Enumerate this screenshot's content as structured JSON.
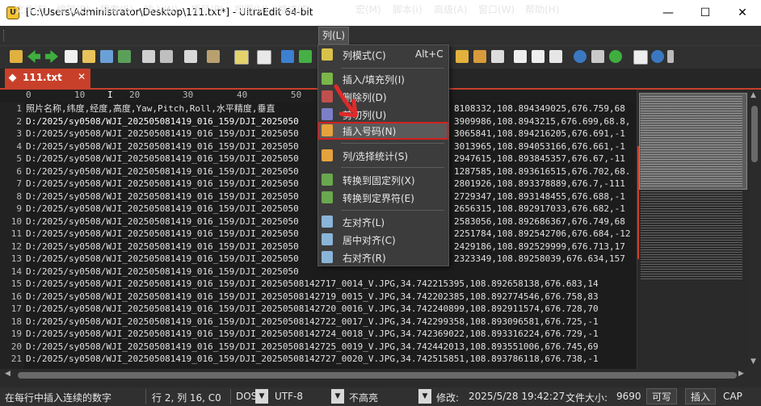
{
  "window": {
    "title": "[C:\\Users\\Administrator\\Desktop\\111.txt*] - UltraEdit 64-bit",
    "app_icon_letter": "U",
    "minimize_glyph": "—",
    "maximize_glyph": "☐",
    "close_glyph": "✕"
  },
  "menubar": {
    "items": [
      "文件(F)",
      "编辑(E)",
      "搜索(S)",
      "插入(N)",
      "项目(P)",
      "视图(V)",
      "格式(T)",
      "列(L)",
      "宏(M)",
      "脚本(i)",
      "高级(A)",
      "窗口(W)",
      "帮助(H)"
    ],
    "active_index": 7
  },
  "tab": {
    "name": "111.txt",
    "close": "✕"
  },
  "ruler": {
    "ticks": [
      "0",
      "10",
      "20",
      "30",
      "40",
      "50"
    ],
    "cursor_mark": "I"
  },
  "editor": {
    "line_numbers": [
      "1",
      "2",
      "3",
      "4",
      "5",
      "6",
      "7",
      "8",
      "9",
      "10",
      "11",
      "12",
      "13",
      "14",
      "15",
      "16",
      "17",
      "18",
      "19",
      "20",
      "21"
    ],
    "lines_left": [
      "照片名称,纬度,经度,高度,Yaw,Pitch,Roll,水平精度,垂直",
      "D:/2025/sy0508/WJI_202505081419_016_159/DJI_2025050",
      "D:/2025/sy0508/WJI_202505081419_016_159/DJI_2025050",
      "D:/2025/sy0508/WJI_202505081419_016_159/DJI_2025050",
      "D:/2025/sy0508/WJI_202505081419_016_159/DJI_2025050",
      "D:/2025/sy0508/WJI_202505081419_016_159/DJI_2025050",
      "D:/2025/sy0508/WJI_202505081419_016_159/DJI_2025050",
      "D:/2025/sy0508/WJI_202505081419_016_159/DJI_2025050",
      "D:/2025/sy0508/WJI_202505081419_016_159/DJI_2025050",
      "D:/2025/sy0508/WJI_202505081419_016_159/DJI_2025050",
      "D:/2025/sy0508/WJI_202505081419_016_159/DJI_2025050",
      "D:/2025/sy0508/WJI_202505081419_016_159/DJI_2025050",
      "D:/2025/sy0508/WJI_202505081419_016_159/DJI_2025050",
      "D:/2025/sy0508/WJI_202505081419_016_159/DJI_2025050",
      "D:/2025/sy0508/WJI_202505081419_016_159/DJI_2025050"
    ],
    "lines_right": [
      "8108332,108.894349025,676.759,68",
      "3909986,108.8943215,676.699,68.8,",
      "3065841,108.894216205,676.691,-1",
      "3013965,108.894053166,676.661,-1",
      "2947615,108.893845357,676.67,-11",
      "1287585,108.893616515,676.702,68.",
      "2801926,108.893378889,676.7,-111",
      "2729347,108.893148455,676.688,-1",
      "2656315,108.892917033,676.682,-1",
      "2583056,108.892686367,676.749,68",
      "2251784,108.892542706,676.684,-12",
      "2429186,108.892529999,676.713,17",
      "2323349,108.89258039,676.634,157"
    ],
    "lines_full": [
      "D:/2025/sy0508/WJI_202505081419_016_159/DJI_20250508142717_0014_V.JPG,34.742215395,108.892658138,676.683,14",
      "D:/2025/sy0508/WJI_202505081419_016_159/DJI_20250508142719_0015_V.JPG,34.742202385,108.892774546,676.758,83",
      "D:/2025/sy0508/WJI_202505081419_016_159/DJI_20250508142720_0016_V.JPG,34.742240899,108.892911574,676.728,70",
      "D:/2025/sy0508/WJI_202505081419_016_159/DJI_20250508142722_0017_V.JPG,34.742299358,108.893096581,676.725,-1",
      "D:/2025/sy0508/WJI_202505081419_016_159/DJI_20250508142724_0018_V.JPG,34.742369022,108.893316224,676.729,-1",
      "D:/2025/sy0508/WJI_202505081419_016_159/DJI_20250508142725_0019_V.JPG,34.742442013,108.893551006,676.745,69",
      "D:/2025/sy0508/WJI_202505081419_016_159/DJI_20250508142727_0020_V.JPG,34.742515851,108.893786118,676.738,-1"
    ]
  },
  "column_menu": {
    "items": [
      {
        "label": "列模式(C)",
        "shortcut": "Alt+C",
        "icon": "column-mode-icon",
        "color": "#d9c24a"
      },
      {
        "label": "插入/填充列(I)",
        "shortcut": "",
        "icon": "insert-fill-column-icon",
        "color": "#7ab648"
      },
      {
        "label": "删除列(D)",
        "shortcut": "",
        "icon": "delete-column-icon",
        "color": "#c0504d"
      },
      {
        "label": "剪切列(U)",
        "shortcut": "",
        "icon": "cut-column-icon",
        "color": "#7a7fc8"
      },
      {
        "label": "插入号码(N)",
        "shortcut": "",
        "icon": "insert-number-icon",
        "color": "#e6a23c"
      },
      {
        "label": "列/选择统计(S)",
        "shortcut": "",
        "icon": "column-stats-icon",
        "color": "#e6a23c"
      },
      {
        "label": "转换到固定列(X)",
        "shortcut": "",
        "icon": "convert-fixed-column-icon",
        "color": "#6aa84f"
      },
      {
        "label": "转换到定界符(E)",
        "shortcut": "",
        "icon": "convert-delimiter-icon",
        "color": "#6aa84f"
      },
      {
        "label": "左对齐(L)",
        "shortcut": "",
        "icon": "align-left-icon",
        "color": "#8ab4d8"
      },
      {
        "label": "居中对齐(C)",
        "shortcut": "",
        "icon": "align-center-icon",
        "color": "#8ab4d8"
      },
      {
        "label": "右对齐(R)",
        "shortcut": "",
        "icon": "align-right-icon",
        "color": "#8ab4d8"
      }
    ],
    "highlighted_index": 4,
    "highlight_color": "#d32020"
  },
  "statusbar": {
    "hint": "在每行中插入连续的数字",
    "position": "行 2, 列 16, C0",
    "line_ending": "DOS",
    "encoding": "UTF-8",
    "highlight": "不高亮",
    "modified": "修改:",
    "modified_time": "2025/5/28 19:42:27",
    "file_size_label": "文件大小:",
    "file_size": "9690",
    "writable": "可写",
    "insert_mode": "插入",
    "caps": "CAP"
  },
  "colors": {
    "accent": "#c8402a",
    "background": "#1c1c1c"
  }
}
